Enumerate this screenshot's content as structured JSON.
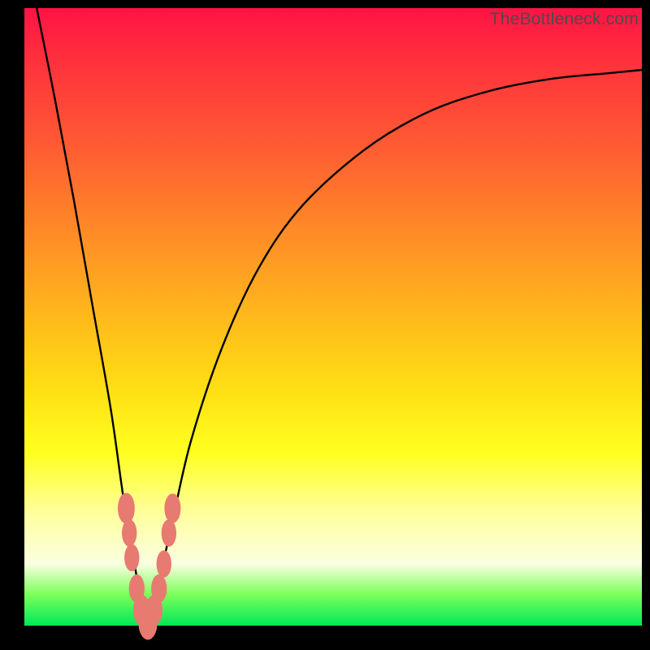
{
  "watermark": "TheBottleneck.com",
  "chart_data": {
    "type": "line",
    "title": "",
    "xlabel": "",
    "ylabel": "",
    "xlim": [
      0,
      100
    ],
    "ylim": [
      0,
      100
    ],
    "curve": {
      "name": "bottleneck-curve",
      "description": "V-shaped curve, 0 at x≈20, rising toward 100 on both sides",
      "x": [
        2,
        5,
        8,
        11,
        14,
        16,
        18,
        19,
        20,
        21,
        22,
        24,
        27,
        32,
        38,
        45,
        55,
        65,
        75,
        85,
        95,
        100
      ],
      "y": [
        100,
        85,
        69,
        52,
        35,
        21,
        9,
        3,
        0,
        3,
        8,
        17,
        30,
        45,
        58,
        68,
        77,
        83,
        86.5,
        88.5,
        89.5,
        90
      ]
    },
    "markers": {
      "name": "highlight-points",
      "color": "#e77a71",
      "points": [
        {
          "x": 16.5,
          "y": 19,
          "r": 2.5
        },
        {
          "x": 17.0,
          "y": 15,
          "r": 2.2
        },
        {
          "x": 17.4,
          "y": 11,
          "r": 2.2
        },
        {
          "x": 18.2,
          "y": 6,
          "r": 2.3
        },
        {
          "x": 19.0,
          "y": 2.5,
          "r": 2.5
        },
        {
          "x": 20.0,
          "y": 0.5,
          "r": 2.8
        },
        {
          "x": 21.0,
          "y": 2.5,
          "r": 2.5
        },
        {
          "x": 21.8,
          "y": 6,
          "r": 2.3
        },
        {
          "x": 22.6,
          "y": 10,
          "r": 2.2
        },
        {
          "x": 23.4,
          "y": 15,
          "r": 2.2
        },
        {
          "x": 24.0,
          "y": 19,
          "r": 2.4
        }
      ]
    }
  }
}
